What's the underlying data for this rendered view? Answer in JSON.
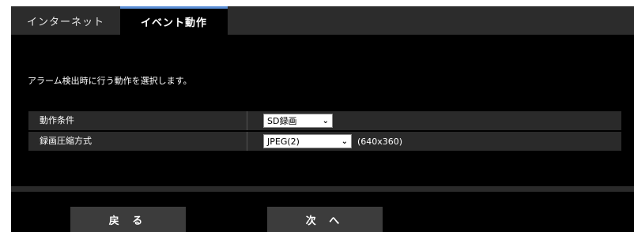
{
  "tabs": [
    {
      "label": "インターネット",
      "active": false
    },
    {
      "label": "イベント動作",
      "active": true
    }
  ],
  "description": "アラーム検出時に行う動作を選択します。",
  "settings": {
    "rows": [
      {
        "label": "動作条件",
        "value": "SD録画",
        "suffix": ""
      },
      {
        "label": "録画圧縮方式",
        "value": "JPEG(2)",
        "suffix": "(640x360)"
      }
    ]
  },
  "buttons": {
    "back": "戻 る",
    "next": "次 へ"
  },
  "colors": {
    "background": "#000000",
    "tab_inactive": "#2c2c2c",
    "tab_active_accent": "#5b8fd6",
    "row_background": "#2a2a2a",
    "button_background": "#3c3c3c"
  },
  "icons": {
    "dropdown": "chevron-down-icon"
  }
}
